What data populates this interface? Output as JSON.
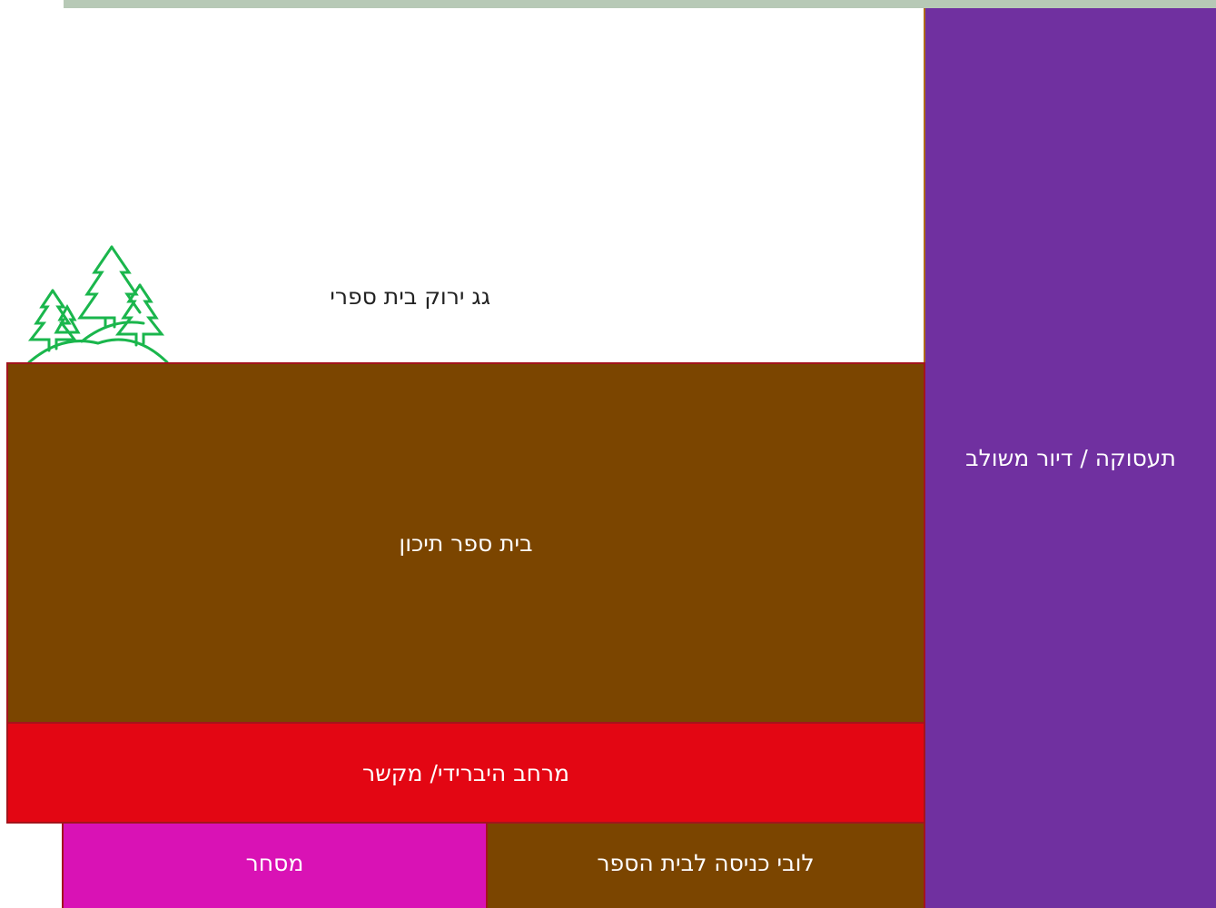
{
  "colors": {
    "top_strip": "#b7c9b6",
    "tower": "#7030a0",
    "school": "#7b4500",
    "hybrid": "#e30613",
    "commerce": "#d912b5",
    "lobby": "#7b4500",
    "trees": "#1ab64c"
  },
  "labels": {
    "green_roof": "גג ירוק בית ספרי",
    "tower": "תעסוקה / דיור משולב",
    "school": "בית ספר תיכון",
    "hybrid": "מרחב היברידי/ מקשר",
    "commerce": "מסחר",
    "lobby": "לובי כניסה לבית הספר"
  },
  "icons": {
    "roof_trees": "trees-icon"
  }
}
